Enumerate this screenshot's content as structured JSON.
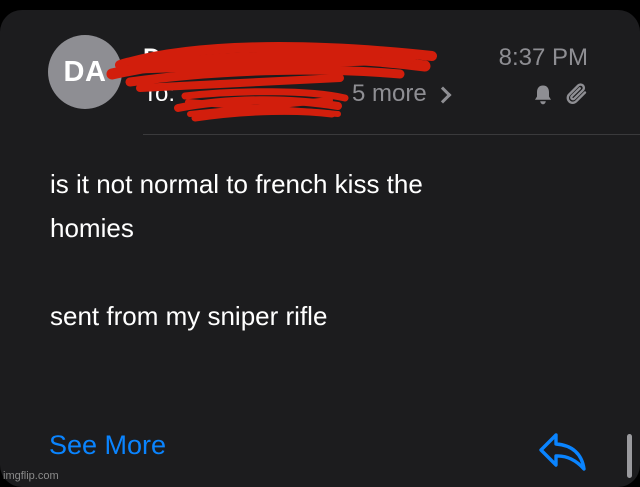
{
  "email": {
    "avatar_initials": "DA",
    "sender": "D                    s",
    "time": "8:37 PM",
    "to_label": "To:",
    "more_recipients": "5 more",
    "body_lines": [
      "is it not normal to french kiss the",
      "homies",
      "",
      "sent from my sniper rifle"
    ],
    "see_more": "See More"
  },
  "icons": {
    "bell": "bell-icon",
    "attachment": "paperclip-icon",
    "reply": "reply-icon",
    "chevron": "chevron-right-icon"
  },
  "colors": {
    "background": "#1c1c1e",
    "link": "#0a84ff",
    "secondary_text": "#8e8e93",
    "redaction": "#d21e0c"
  },
  "watermark": "imgflip.com"
}
